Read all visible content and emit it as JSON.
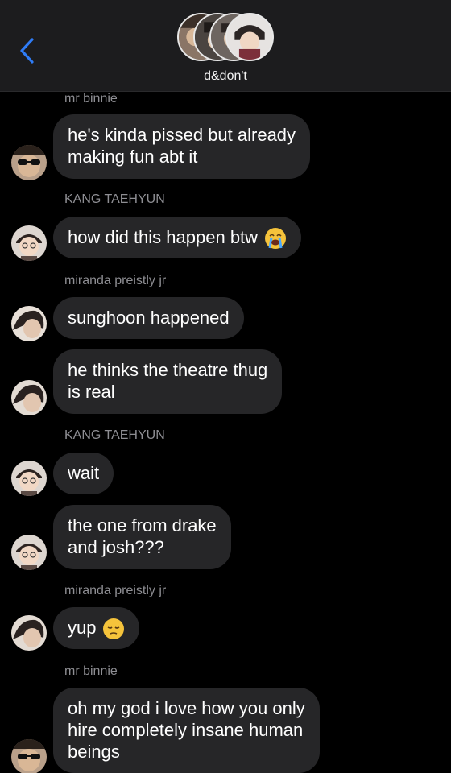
{
  "header": {
    "group_name": "d&don't",
    "back_icon": "chevron-left-icon",
    "accent": "#2f7cf6"
  },
  "messages": [
    {
      "sender": "mr binnie",
      "lines": [
        "he's kinda pissed but already",
        "making fun abt it"
      ]
    },
    {
      "sender": "KANG TAEHYUN",
      "text": "how did this happen btw",
      "emoji": "loudly-crying-face-icon"
    },
    {
      "sender": "miranda preistly jr",
      "text": "sunghoon happened"
    },
    {
      "lines": [
        "he thinks the theatre thug",
        "is real"
      ]
    },
    {
      "sender": "KANG TAEHYUN",
      "text": "wait"
    },
    {
      "lines": [
        "the one from drake",
        "and josh???"
      ]
    },
    {
      "sender": "miranda preistly jr",
      "text": "yup",
      "emoji": "pensive-face-icon"
    },
    {
      "sender": "mr binnie",
      "lines": [
        "oh my god i love how you only",
        "hire completely insane human",
        "beings"
      ]
    }
  ],
  "colors": {
    "bubble": "#262628",
    "sender_name": "#8e8e93",
    "header_bg": "#1c1c1e"
  }
}
